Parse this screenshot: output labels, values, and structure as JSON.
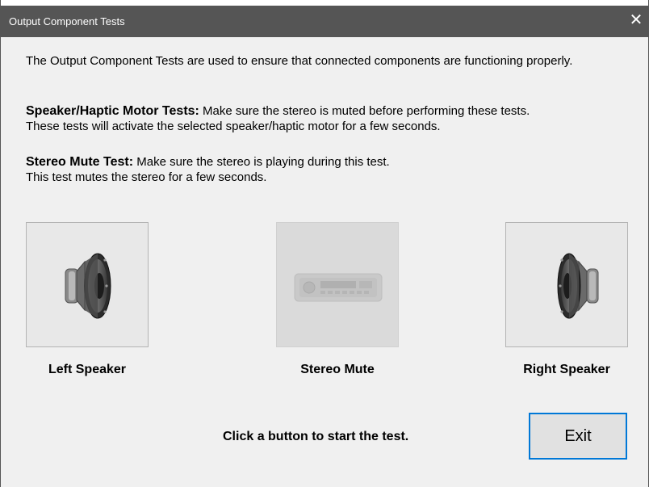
{
  "window": {
    "title": "Output Component Tests",
    "close_symbol": "✕"
  },
  "instructions": {
    "intro": "The Output Component Tests are used to ensure that connected components are functioning properly.",
    "speaker_heading": "Speaker/Haptic Motor Tests:",
    "speaker_text": " Make sure the stereo is muted before performing these tests.",
    "speaker_text2": "These tests will activate the selected speaker/haptic motor for a few seconds.",
    "mute_heading": "Stereo Mute Test:",
    "mute_text": " Make sure the stereo is playing during this test.",
    "mute_text2": "This test mutes the stereo for a few seconds."
  },
  "tiles": {
    "left_speaker": {
      "label": "Left Speaker",
      "icon": "speaker-icon",
      "enabled": true
    },
    "stereo_mute": {
      "label": "Stereo Mute",
      "icon": "car-stereo-icon",
      "enabled": false
    },
    "right_speaker": {
      "label": "Right Speaker",
      "icon": "speaker-icon",
      "enabled": true
    }
  },
  "footer": {
    "hint": "Click a button to start the test.",
    "exit_label": "Exit"
  },
  "colors": {
    "titlebar": "#555555",
    "accent_border": "#0078d7"
  }
}
